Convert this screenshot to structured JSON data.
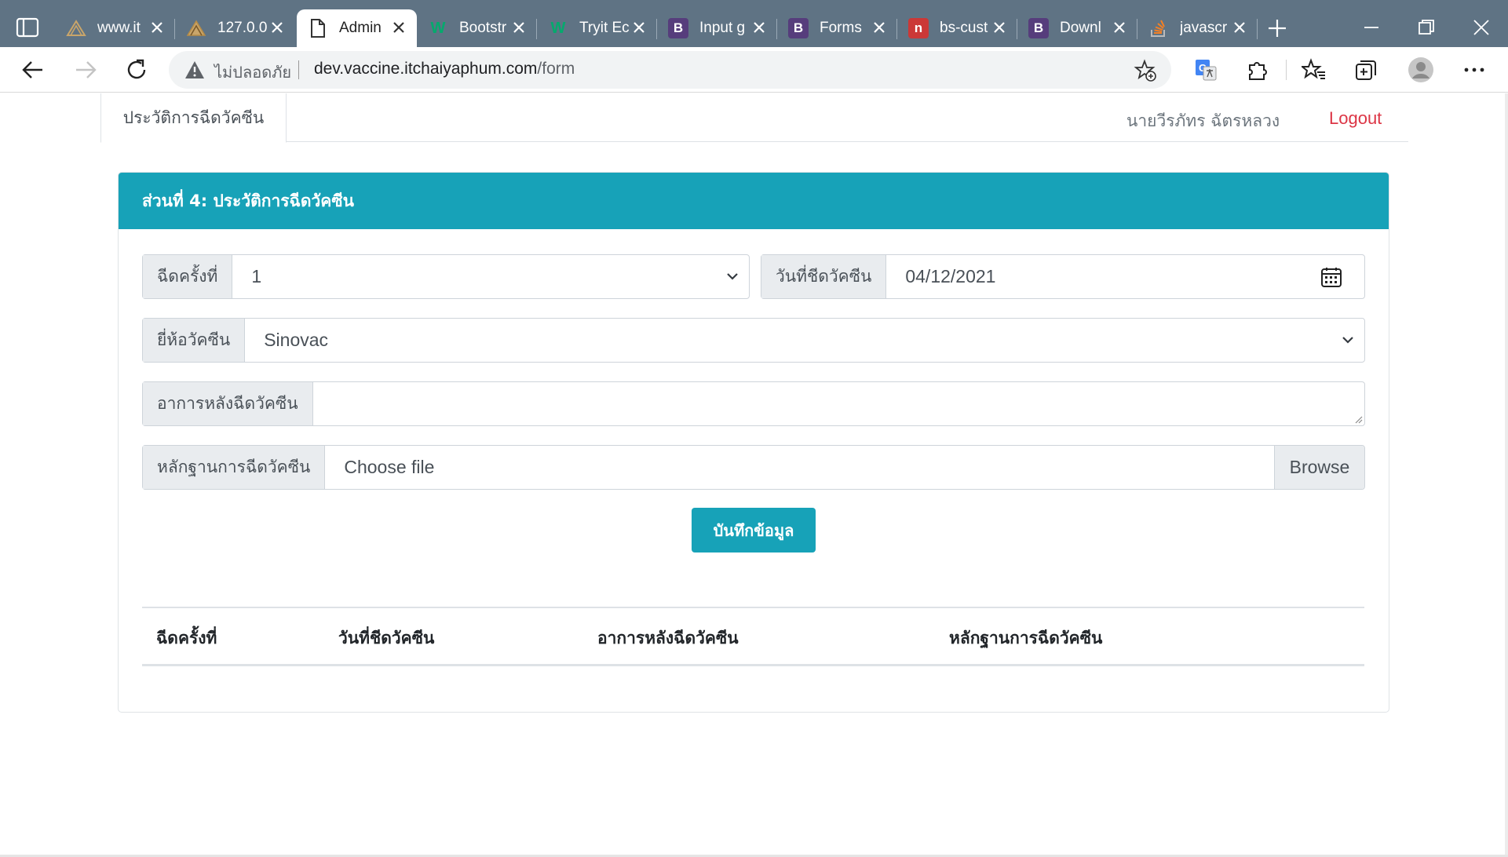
{
  "browser": {
    "tabs": [
      {
        "title": "www.it",
        "favicon": "temple-icon",
        "active": false
      },
      {
        "title": "127.0.0",
        "favicon": "temple-icon",
        "active": false
      },
      {
        "title": "Admin",
        "favicon": "page-icon",
        "active": true
      },
      {
        "title": "Bootstr",
        "favicon": "w3schools-icon",
        "active": false
      },
      {
        "title": "Tryit Ec",
        "favicon": "w3schools-icon",
        "active": false
      },
      {
        "title": "Input g",
        "favicon": "bootstrap-icon",
        "active": false
      },
      {
        "title": "Forms",
        "favicon": "bootstrap-icon",
        "active": false
      },
      {
        "title": "bs-cust",
        "favicon": "npm-icon",
        "active": false
      },
      {
        "title": "Downl",
        "favicon": "bootstrap-icon",
        "active": false
      },
      {
        "title": "javascr",
        "favicon": "stackoverflow-icon",
        "active": false
      }
    ],
    "security_label": "ไม่ปลอดภัย",
    "url_host": "dev.vaccine.itchaiyaphum.com",
    "url_path": "/form"
  },
  "nav": {
    "active_tab": "ประวัติการฉีดวัคซีน",
    "username": "นายวีรภัทร ฉัตรหลวง",
    "logout": "Logout"
  },
  "form": {
    "header": "ส่วนที่ 4: ประวัติการฉีดวัคซีน",
    "dose_label": "ฉีดครั้งที่",
    "dose_value": "1",
    "date_label": "วันที่ชีดวัคซีน",
    "date_value": "04/12/2021",
    "brand_label": "ยี่ห้อวัคซีน",
    "brand_value": "Sinovac",
    "symptoms_label": "อาการหลังฉีดวัคซีน",
    "symptoms_value": "",
    "proof_label": "หลักฐานการฉีดวัคซีน",
    "file_placeholder": "Choose file",
    "browse_label": "Browse",
    "save_label": "บันทึกข้อมูล"
  },
  "table": {
    "headers": [
      "ฉีดครั้งที่",
      "วันที่ชีดวัคซีน",
      "อาการหลังฉีดวัคซีน",
      "หลักฐานการฉีดวัคซีน"
    ]
  },
  "colors": {
    "primary": "#17a2b8",
    "danger": "#dc3545",
    "tabbar": "#5f7384"
  }
}
